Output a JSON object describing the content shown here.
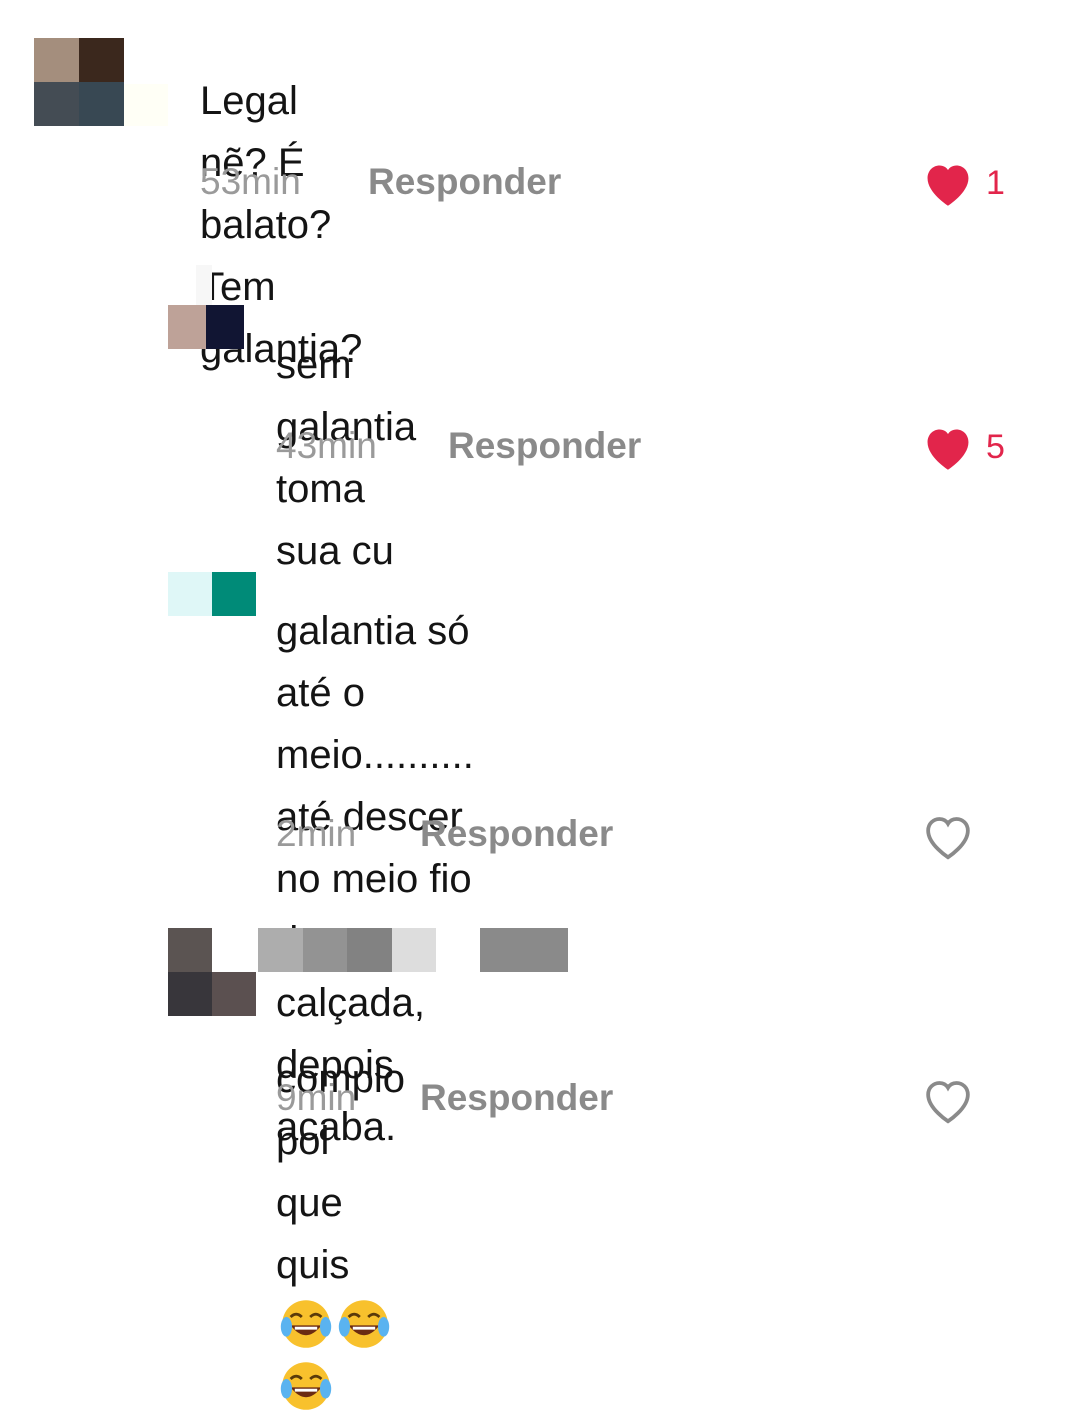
{
  "comments": [
    {
      "text": "Legal nẽ? É balato? Tem galantia?",
      "time": "53min",
      "reply_label": "Responder",
      "likes": "1",
      "liked": true
    },
    {
      "text": "sem galantia toma sua cu",
      "time": "43min",
      "reply_label": "Responder",
      "likes": "5",
      "liked": true
    },
    {
      "text": "galantia só até o meio..........\naté descer no meio fio da calçada,\ndepois acaba.",
      "time": "2min",
      "reply_label": "Responder",
      "liked": false
    },
    {
      "text": "complo pol que quis",
      "emojis": [
        "face-with-tears-of-joy-icon",
        "face-with-tears-of-joy-icon",
        "face-with-tears-of-joy-icon"
      ],
      "time": "9min",
      "reply_label": "Responder",
      "liked": false
    }
  ],
  "colors": {
    "like_red": "#e2254b",
    "muted_gray": "#9a9a9a",
    "reply_gray": "#8a8a8a"
  }
}
